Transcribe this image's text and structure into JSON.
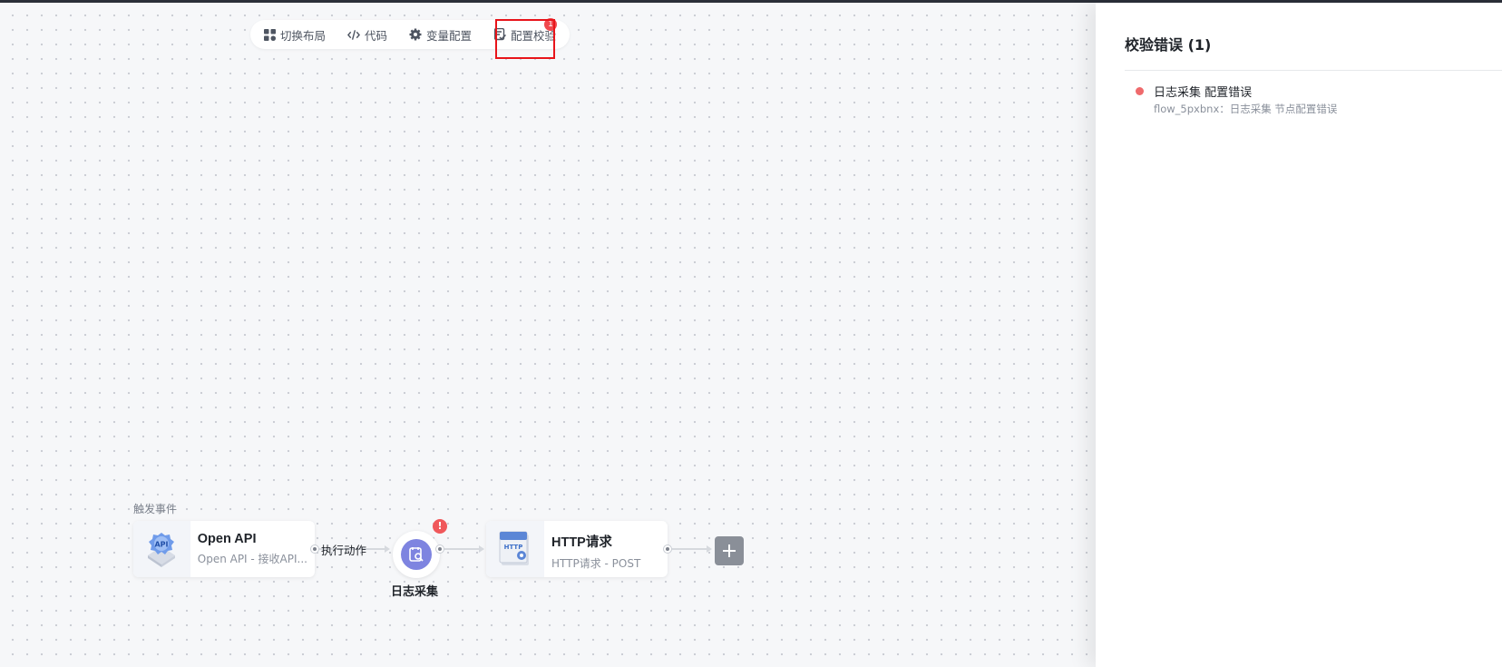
{
  "toolbar": {
    "items": [
      {
        "label": "切换布局",
        "icon": "layout-grid-icon"
      },
      {
        "label": "代码",
        "icon": "code-icon"
      },
      {
        "label": "变量配置",
        "icon": "gear-icon"
      },
      {
        "label": "配置校验",
        "icon": "checklist-icon"
      }
    ],
    "badge_count": "1"
  },
  "flow": {
    "trigger_label": "触发事件",
    "edge_label": "执行动作",
    "nodes": {
      "open_api": {
        "title": "Open API",
        "subtitle": "Open API - 接收API...",
        "icon": "api-icon"
      },
      "log": {
        "title": "日志采集",
        "icon": "log-search-icon",
        "error_mark": "!"
      },
      "http": {
        "title": "HTTP请求",
        "subtitle": "HTTP请求 - POST",
        "icon": "http-icon"
      }
    },
    "add_icon": "plus-icon"
  },
  "panel": {
    "title": "校验错误 (1)",
    "errors": [
      {
        "title": "日志采集 配置错误",
        "detail": "flow_5pxbnx：日志采集 节点配置错误"
      }
    ]
  },
  "colors": {
    "accent_error": "#f0484d",
    "log_node": "#7e84e0",
    "highlight": "#e8141a"
  }
}
